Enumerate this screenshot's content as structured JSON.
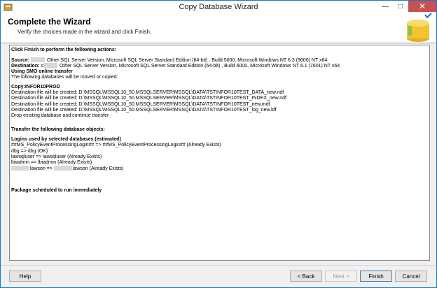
{
  "window": {
    "title": "Copy Database Wizard"
  },
  "header": {
    "title": "Complete the Wizard",
    "subtitle": "Verify the choices made in the wizard and click Finish."
  },
  "summary": {
    "heading": "Click Finish to perform the following actions:",
    "source_label": "Source:",
    "source_text": "Other SQL Server Version, Microsoft SQL Server Standard Edition (64-bit) , Build 5000, Microsoft Windows NT 6.3 (9600) NT x64",
    "destination_label": "Destination:",
    "destination_prefix": "s",
    "destination_text": "Other SQL Server Version, Microsoft SQL Server Standard Edition (64-bit) , Build 6000, Microsoft Windows NT 6.1 (7601) NT x64",
    "transfer_method": "Using SMO online transfer",
    "moved_note": "The following databases will be moved or copied:",
    "copy_db": "Copy:INFOR10PROD",
    "files": [
      "Destination file will be created: D:\\MSSQL\\MSSQL10_50.MSSQLSERVER\\MSSQL\\DATA\\TSTINFOR10TEST_DATA_new.ndf",
      "Destination file will be created: D:\\MSSQL\\MSSQL10_50.MSSQLSERVER\\MSSQL\\DATA\\TSTINFOR10TEST_INDEX_new.ndf",
      "Destination file will be created: D:\\MSSQL\\MSSQL10_50.MSSQLSERVER\\MSSQL\\DATA\\TSTINFOR10TEST_new.mdf",
      "Destination file will be created: D:\\MSSQL\\MSSQL10_50.MSSQLSERVER\\MSSQL\\DATA\\TSTINFOR10TEST_log_new.ldf"
    ],
    "drop_note": "Drop existing database and continue transfer",
    "objects_heading": "Transfer the following database objects:",
    "logins_heading": "Logins used by selected databases (estimated)",
    "logins": [
      "##MS_PolicyEventProcessingLogin## => ##MS_PolicyEventProcessingLogin## (Already Exists)",
      "dbg => dbg (OK)",
      "lawsqluser => lawsqluser (Already Exists)",
      "lbiadmin => lbiadmin (Already Exists)"
    ],
    "login_redacted_left": "lawson =>",
    "login_redacted_right": "lawson (Already Exists)",
    "schedule": "Package scheduled to run immediately"
  },
  "buttons": {
    "help": "Help",
    "back": "< Back",
    "next": "Next >",
    "finish": "Finish",
    "cancel": "Cancel"
  }
}
